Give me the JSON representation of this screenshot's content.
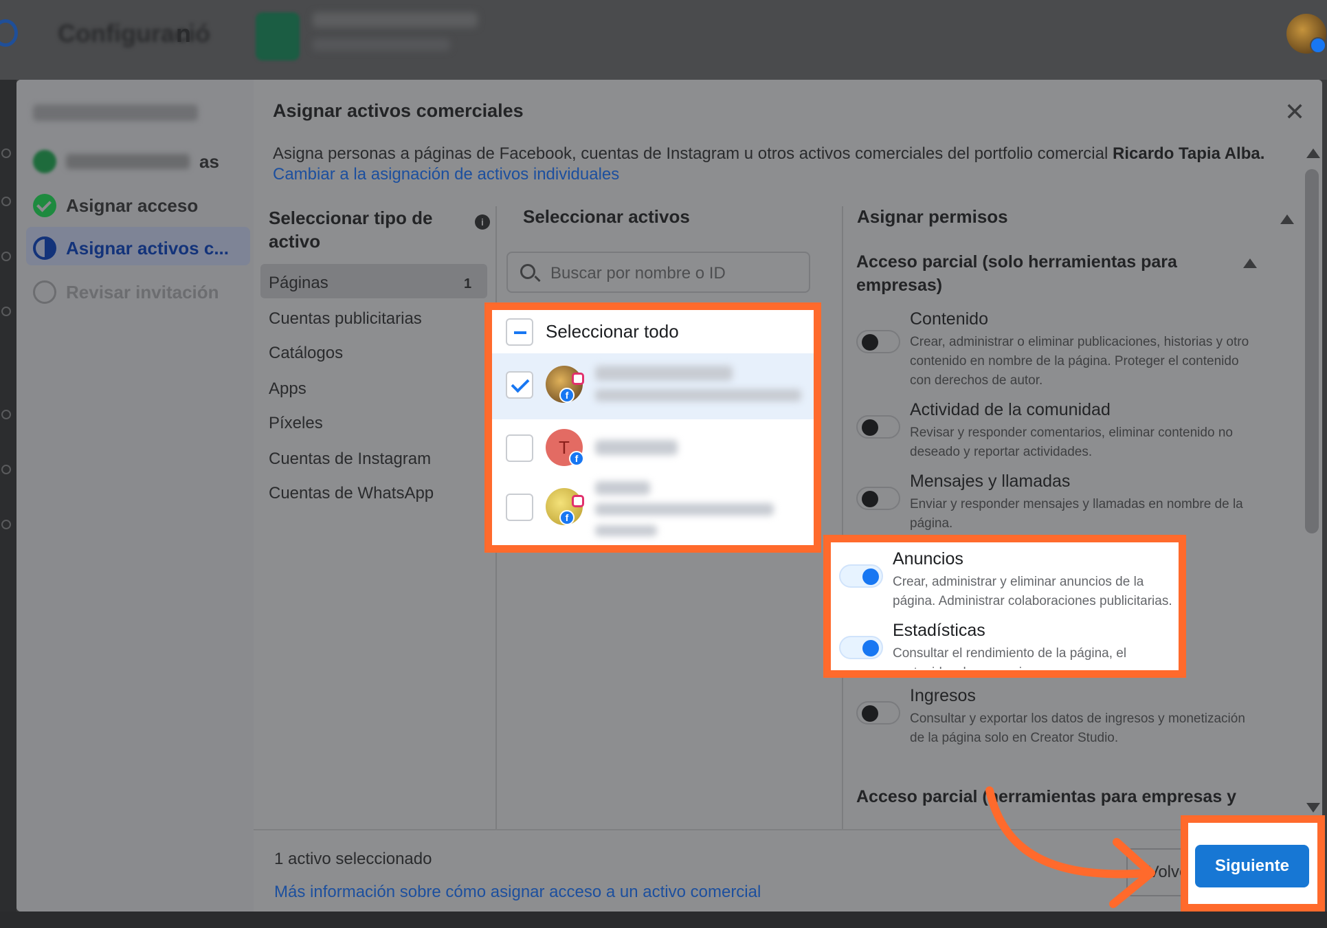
{
  "topbar": {
    "title_end": "n"
  },
  "steps": {
    "items": [
      {
        "label": "as"
      },
      {
        "label": "Asignar acceso"
      },
      {
        "label": "Asignar activos c..."
      },
      {
        "label": "Revisar invitación"
      }
    ]
  },
  "dialog": {
    "title": "Asignar activos comerciales",
    "close_label": "✕",
    "description": "Asigna personas a páginas de Facebook, cuentas de Instagram u otros activos comerciales del portfolio comercial",
    "portfolio_name": "Ricardo Tapia Alba.",
    "switch_link": "Cambiar a la asignación de activos individuales"
  },
  "asset_types": {
    "header": "Seleccionar tipo de activo",
    "items": [
      {
        "label": "Páginas",
        "count": "1"
      },
      {
        "label": "Cuentas publicitarias"
      },
      {
        "label": "Catálogos"
      },
      {
        "label": "Apps"
      },
      {
        "label": "Píxeles"
      },
      {
        "label": "Cuentas de Instagram"
      },
      {
        "label": "Cuentas de WhatsApp"
      }
    ]
  },
  "assets": {
    "header": "Seleccionar activos",
    "search_placeholder": "Buscar por nombre o ID",
    "select_all": "Seleccionar todo",
    "rows": [
      {
        "initial": "",
        "checked": true
      },
      {
        "initial": "T",
        "checked": false
      },
      {
        "initial": "",
        "checked": false
      }
    ]
  },
  "permissions": {
    "header": "Asignar permisos",
    "section1": "Acceso parcial (solo herramientas para empresas)",
    "items": [
      {
        "name": "Contenido",
        "desc": "Crear, administrar o eliminar publicaciones, historias y otro contenido en nombre de la página. Proteger el contenido con derechos de autor.",
        "on": false
      },
      {
        "name": "Actividad de la comunidad",
        "desc": "Revisar y responder comentarios, eliminar contenido no deseado y reportar actividades.",
        "on": false
      },
      {
        "name": "Mensajes y llamadas",
        "desc": "Enviar y responder mensajes y llamadas en nombre de la página.",
        "on": false
      },
      {
        "name": "Anuncios",
        "desc": "Crear, administrar y eliminar anuncios de la página. Administrar colaboraciones publicitarias.",
        "on": true
      },
      {
        "name": "Estadísticas",
        "desc": "Consultar el rendimiento de la página, el contenido y los anuncios.",
        "on": true
      },
      {
        "name": "Ingresos",
        "desc": "Consultar y exportar los datos de ingresos y monetización de la página solo en Creator Studio.",
        "on": false
      }
    ],
    "section2": "Acceso parcial (herramientas para empresas y Facebook)"
  },
  "footer": {
    "selected_count": "1 activo seleccionado",
    "help_link": "Más información sobre cómo asignar acceso a un activo comercial",
    "back_label": "Volver",
    "next_label": "Siguiente"
  },
  "colors": {
    "highlight": "#ff6a2c",
    "primary": "#1877f2"
  }
}
